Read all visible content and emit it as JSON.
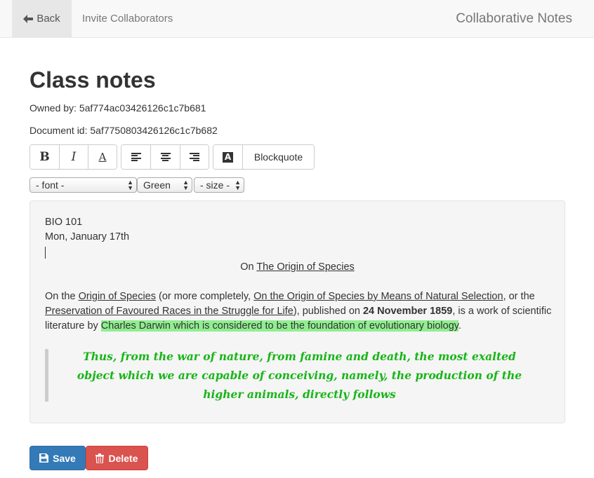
{
  "navbar": {
    "back_label": "Back",
    "invite_label": "Invite Collaborators",
    "brand": "Collaborative Notes",
    "back_icon": "arrow-left-icon"
  },
  "document": {
    "title": "Class notes",
    "owner_text": "Owned by: 5af774ac03426126c1c7b681",
    "docid_text": "Document id: 5af7750803426126c1c7b682"
  },
  "toolbar": {
    "bold": "B",
    "italic": "I",
    "underline": "A",
    "color_letter": "A",
    "blockquote_label": "Blockquote",
    "icons": [
      "bold-icon",
      "italic-icon",
      "underline-icon",
      "align-left-icon",
      "align-center-icon",
      "align-right-icon",
      "text-color-icon"
    ]
  },
  "selects": {
    "font": "- font -",
    "color": "Green",
    "size": "- size -"
  },
  "editor": {
    "line1": "BIO 101",
    "line2": "Mon, January 17th",
    "heading_prefix": "On ",
    "heading_link": "The Origin of Species",
    "para": {
      "t1": "On the ",
      "u1": "Origin of Species",
      "t2": " (or more completely, ",
      "u2": "On the Origin of Species by Means of Natural Selection",
      "t3": ", or the ",
      "u3": "Preservation of Favoured Races in the Struggle for Life",
      "t4": "), published on ",
      "b1": "24 November 1859",
      "t5": ", is a work of scientific literature by ",
      "hl": "Charles Darwin which is considered to be the foundation of evolutionary biology",
      "t6": "."
    },
    "quote": "Thus, from the war of nature, from famine and death, the most exalted object which we are capable of conceiving, namely, the production of the higher animals, directly follows",
    "highlight_color": "#90ee90",
    "quote_color": "#18b518"
  },
  "actions": {
    "save_label": "Save",
    "delete_label": "Delete",
    "save_color": "#337ab7",
    "delete_color": "#d9534f"
  }
}
